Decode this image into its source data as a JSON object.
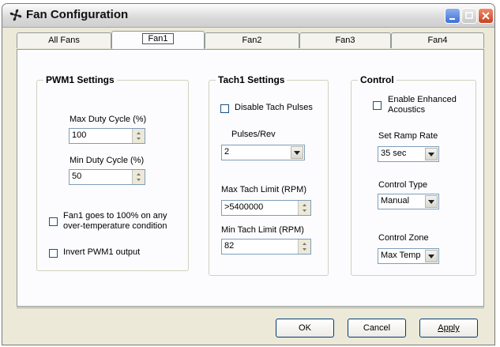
{
  "window": {
    "title": "Fan Configuration",
    "icon": "fan-icon"
  },
  "tabs": [
    {
      "label": "All Fans",
      "selected": false
    },
    {
      "label": "Fan1",
      "selected": true
    },
    {
      "label": "Fan2",
      "selected": false
    },
    {
      "label": "Fan3",
      "selected": false
    },
    {
      "label": "Fan4",
      "selected": false
    }
  ],
  "pwm": {
    "title": "PWM1 Settings",
    "max_duty_label": "Max Duty Cycle (%)",
    "max_duty_value": "100",
    "min_duty_label": "Min Duty Cycle  (%)",
    "min_duty_value": "50",
    "overtemp_label_1": "Fan1 goes to 100% on any",
    "overtemp_label_2": "over-temperature condition",
    "overtemp_checked": false,
    "invert_label": "Invert PWM1 output",
    "invert_checked": false
  },
  "tach": {
    "title": "Tach1 Settings",
    "disable_label": "Disable Tach Pulses",
    "disable_checked": false,
    "pulses_label": "Pulses/Rev",
    "pulses_value": "2",
    "max_limit_label": "Max Tach Limit (RPM)",
    "max_limit_value": ">5400000",
    "min_limit_label": "Min Tach Limit  (RPM)",
    "min_limit_value": "82"
  },
  "control": {
    "title": "Control",
    "enhanced_label_1": "Enable Enhanced",
    "enhanced_label_2": "Acoustics",
    "enhanced_checked": false,
    "ramp_label": "Set Ramp Rate",
    "ramp_value": "35 sec",
    "type_label": "Control Type",
    "type_value": "Manual",
    "zone_label": "Control Zone",
    "zone_value": "Max Temp"
  },
  "buttons": {
    "ok": "OK",
    "cancel": "Cancel",
    "apply": "Apply"
  }
}
